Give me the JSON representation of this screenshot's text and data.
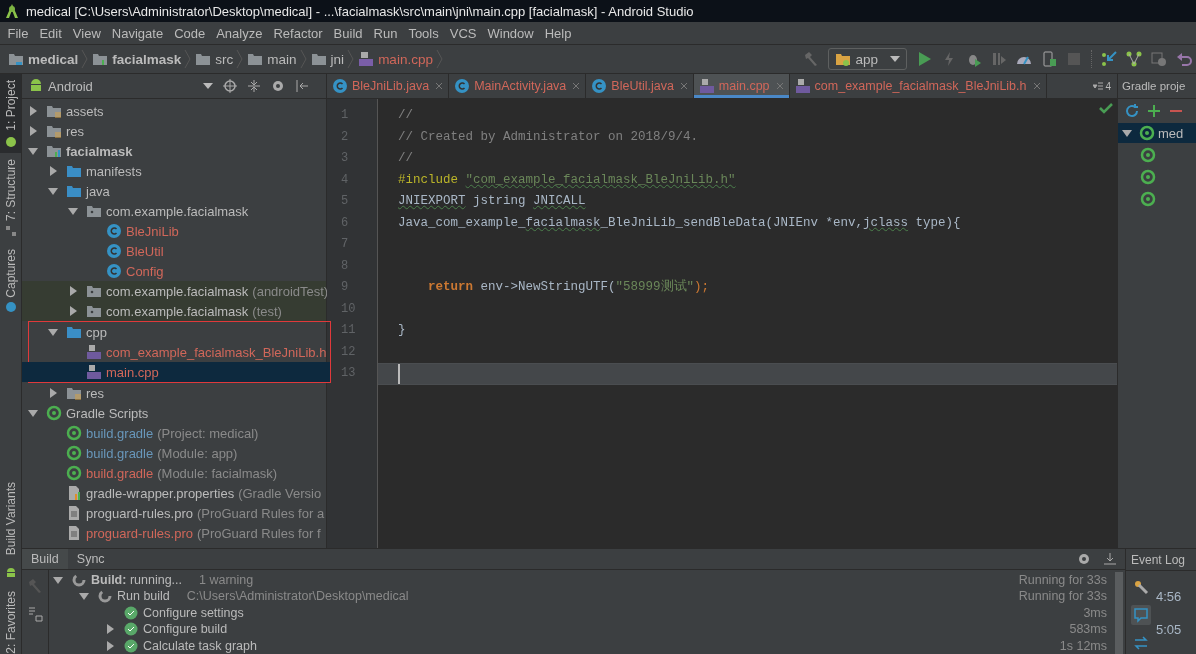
{
  "window": {
    "title": "medical [C:\\Users\\Administrator\\Desktop\\medical] - ...\\facialmask\\src\\main\\jni\\main.cpp [facialmask] - Android Studio"
  },
  "menu": [
    "File",
    "Edit",
    "View",
    "Navigate",
    "Code",
    "Analyze",
    "Refactor",
    "Build",
    "Run",
    "Tools",
    "VCS",
    "Window",
    "Help"
  ],
  "breadcrumb": [
    {
      "label": "medical",
      "kind": "project"
    },
    {
      "label": "facialmask",
      "kind": "module"
    },
    {
      "label": "src",
      "kind": "folder"
    },
    {
      "label": "main",
      "kind": "folder"
    },
    {
      "label": "jni",
      "kind": "folder"
    },
    {
      "label": "main.cpp",
      "kind": "cpp"
    }
  ],
  "run_config": "app",
  "side_tabs": [
    {
      "label": "1: Project",
      "selected": true,
      "kind": "project"
    },
    {
      "label": "7: Structure",
      "selected": false,
      "kind": "structure"
    },
    {
      "label": "Captures",
      "selected": false,
      "kind": "captures"
    },
    {
      "label": "Build Variants",
      "selected": false,
      "kind": "variants"
    },
    {
      "label": "2: Favorites",
      "selected": false,
      "kind": "favorites"
    }
  ],
  "project": {
    "view": "Android",
    "tree": [
      {
        "label": "assets",
        "kind": "res-folder",
        "color": "#bbbbbb",
        "expanded": false,
        "selected": false
      },
      {
        "label": "res",
        "kind": "res-folder",
        "color": "#bbbbbb",
        "expanded": false,
        "selected": false
      },
      {
        "label": "facialmask",
        "kind": "module",
        "color": "#bbbbbb",
        "expanded": true,
        "selected": false,
        "children": [
          {
            "label": "manifests",
            "kind": "folder",
            "color": "#bbbbbb",
            "expanded": false,
            "selected": false
          },
          {
            "label": "java",
            "kind": "folder",
            "color": "#bbbbbb",
            "expanded": true,
            "selected": false,
            "children": [
              {
                "label": "com.example.facialmask",
                "kind": "package",
                "color": "#bbbbbb",
                "expanded": true,
                "selected": false,
                "children": [
                  {
                    "label": "BleJniLib",
                    "kind": "class",
                    "color": "#d1675a",
                    "selected": false
                  },
                  {
                    "label": "BleUtil",
                    "kind": "class",
                    "color": "#d1675a",
                    "selected": false
                  },
                  {
                    "label": "Config",
                    "kind": "class",
                    "color": "#d1675a",
                    "selected": false
                  }
                ]
              },
              {
                "label": "com.example.facialmask",
                "note": "(androidTest)",
                "kind": "package",
                "test": true,
                "color": "#bbbbbb",
                "expanded": false,
                "selected": false
              },
              {
                "label": "com.example.facialmask",
                "note": "(test)",
                "kind": "package",
                "test": true,
                "color": "#bbbbbb",
                "expanded": false,
                "selected": false
              }
            ]
          },
          {
            "label": "cpp",
            "kind": "folder",
            "color": "#bbbbbb",
            "expanded": true,
            "selected": false,
            "annotated": true,
            "children": [
              {
                "label": "com_example_facialmask_BleJniLib.h",
                "kind": "cpp",
                "color": "#d1675a",
                "selected": false
              },
              {
                "label": "main.cpp",
                "kind": "cpp",
                "color": "#d1675a",
                "selected": true
              }
            ]
          },
          {
            "label": "res",
            "kind": "res-folder",
            "color": "#bbbbbb",
            "expanded": false,
            "selected": false
          }
        ]
      },
      {
        "label": "Gradle Scripts",
        "kind": "gradle",
        "color": "#bbbbbb",
        "expanded": true,
        "selected": false,
        "children": [
          {
            "label": "build.gradle",
            "note": "(Project: medical)",
            "kind": "gradle",
            "color": "#6897bb",
            "selected": false
          },
          {
            "label": "build.gradle",
            "note": "(Module: app)",
            "kind": "gradle",
            "color": "#6897bb",
            "selected": false
          },
          {
            "label": "build.gradle",
            "note": "(Module: facialmask)",
            "kind": "gradle",
            "color": "#d1675a",
            "selected": false
          },
          {
            "label": "gradle-wrapper.properties",
            "note": "(Gradle Versio",
            "kind": "properties",
            "color": "#bbbbbb",
            "selected": false
          },
          {
            "label": "proguard-rules.pro",
            "note": "(ProGuard Rules for a",
            "kind": "file",
            "color": "#bbbbbb",
            "selected": false
          },
          {
            "label": "proguard-rules.pro",
            "note": "(ProGuard Rules for f",
            "kind": "file",
            "color": "#d1675a",
            "selected": false
          }
        ]
      }
    ]
  },
  "editor": {
    "tabs": [
      {
        "label": "BleJniLib.java",
        "kind": "class",
        "selected": false
      },
      {
        "label": "MainActivity.java",
        "kind": "class",
        "selected": false
      },
      {
        "label": "BleUtil.java",
        "kind": "class",
        "selected": false
      },
      {
        "label": "main.cpp",
        "kind": "cpp",
        "selected": true
      },
      {
        "label": "com_example_facialmask_BleJniLib.h",
        "kind": "cpp",
        "selected": false
      }
    ],
    "tab_count": "4",
    "lines": [
      {
        "number": "1",
        "current": false,
        "tokens": [
          {
            "text": "//",
            "kind": "comment"
          }
        ]
      },
      {
        "number": "2",
        "current": false,
        "tokens": [
          {
            "text": "// Created by Administrator on 2018/9/4.",
            "kind": "comment"
          }
        ]
      },
      {
        "number": "3",
        "current": false,
        "tokens": [
          {
            "text": "//",
            "kind": "comment"
          }
        ]
      },
      {
        "number": "4",
        "current": false,
        "tokens": [
          {
            "text": "#include ",
            "kind": "directive"
          },
          {
            "text": "\"com_example_facialmask_BleJniLib.h\"",
            "kind": "string-warn"
          }
        ]
      },
      {
        "number": "5",
        "current": false,
        "tokens": [
          {
            "text": "JNIEXPORT",
            "kind": "warn"
          },
          {
            "text": " jstring ",
            "kind": "plain"
          },
          {
            "text": "JNICALL",
            "kind": "warn"
          }
        ]
      },
      {
        "number": "6",
        "current": false,
        "tokens": [
          {
            "text": "Java_com_example_",
            "kind": "plain"
          },
          {
            "text": "facialmask",
            "kind": "warn"
          },
          {
            "text": "_BleJniLib_sendBleData(JNIEnv *env,",
            "kind": "plain"
          },
          {
            "text": "jclass",
            "kind": "warn"
          },
          {
            "text": " type){",
            "kind": "plain"
          }
        ]
      },
      {
        "number": "7",
        "current": false
      },
      {
        "number": "8",
        "current": false
      },
      {
        "number": "9",
        "current": false,
        "indented": true,
        "tokens": [
          {
            "text": "return",
            "kind": "keyword"
          },
          {
            "text": " env->NewStringUTF(",
            "kind": "plain"
          },
          {
            "text": "\"58999测试\"",
            "kind": "string"
          },
          {
            "text": ");",
            "kind": "punct"
          }
        ]
      },
      {
        "number": "10",
        "current": false
      },
      {
        "number": "11",
        "current": false,
        "tokens": [
          {
            "text": "}",
            "kind": "plain"
          }
        ]
      },
      {
        "number": "12",
        "current": false
      },
      {
        "number": "13",
        "current": true
      }
    ]
  },
  "gradle": {
    "title": "Gradle proje",
    "root": "med"
  },
  "build": {
    "tabs": [
      {
        "label": "Build",
        "selected": true
      },
      {
        "label": "Sync",
        "selected": false
      }
    ],
    "rows": [
      {
        "label": "**Build:** running...",
        "note": "1 warning",
        "kind": "running",
        "time": "Running for 33s",
        "expanded": true,
        "children": [
          {
            "label": "Run build",
            "note": "C:\\Users\\Administrator\\Desktop\\medical",
            "kind": "running",
            "time": "Running for 33s",
            "expanded": true,
            "children": [
              {
                "label": "Configure settings",
                "kind": "ok",
                "time": "3ms"
              },
              {
                "label": "Configure build",
                "kind": "ok",
                "time": "583ms",
                "expanded": false
              },
              {
                "label": "Calculate task graph",
                "kind": "ok",
                "time": "1s 12ms",
                "expanded": false
              }
            ]
          }
        ]
      }
    ]
  },
  "event_log": {
    "title": "Event Log",
    "times": [
      "4:56",
      "5:05"
    ]
  }
}
